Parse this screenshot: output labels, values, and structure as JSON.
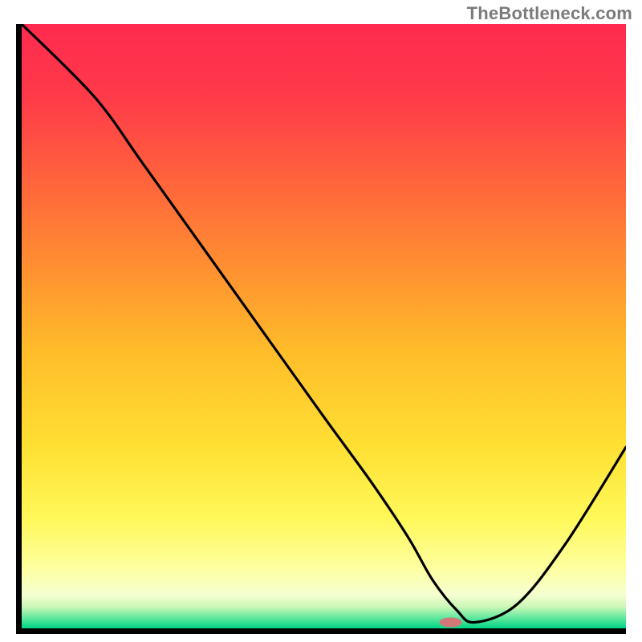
{
  "watermark": "TheBottleneck.com",
  "chart_data": {
    "type": "line",
    "title": "",
    "xlabel": "",
    "ylabel": "",
    "xlim": [
      0,
      100
    ],
    "ylim": [
      0,
      100
    ],
    "grid": false,
    "legend": false,
    "series": [
      {
        "name": "curve",
        "x": [
          0,
          12,
          20,
          30,
          40,
          50,
          58,
          64,
          68,
          72,
          75,
          82,
          90,
          100
        ],
        "values": [
          100,
          88,
          77,
          63,
          49,
          35,
          24,
          15,
          8,
          3,
          1,
          4,
          14,
          30
        ]
      }
    ],
    "marker": {
      "x": 71,
      "y": 1,
      "color": "#d27878",
      "rx": 14,
      "ry": 6
    },
    "gradient_stops": [
      {
        "offset": 0.0,
        "color": "#ff2a4f"
      },
      {
        "offset": 0.12,
        "color": "#ff3a49"
      },
      {
        "offset": 0.28,
        "color": "#ff6a3a"
      },
      {
        "offset": 0.42,
        "color": "#ff9530"
      },
      {
        "offset": 0.55,
        "color": "#ffbf2a"
      },
      {
        "offset": 0.7,
        "color": "#ffe033"
      },
      {
        "offset": 0.82,
        "color": "#fff95a"
      },
      {
        "offset": 0.9,
        "color": "#fdffa0"
      },
      {
        "offset": 0.945,
        "color": "#f6ffd0"
      },
      {
        "offset": 0.965,
        "color": "#c8f7b6"
      },
      {
        "offset": 0.985,
        "color": "#52e59a"
      },
      {
        "offset": 1.0,
        "color": "#00d486"
      }
    ]
  }
}
